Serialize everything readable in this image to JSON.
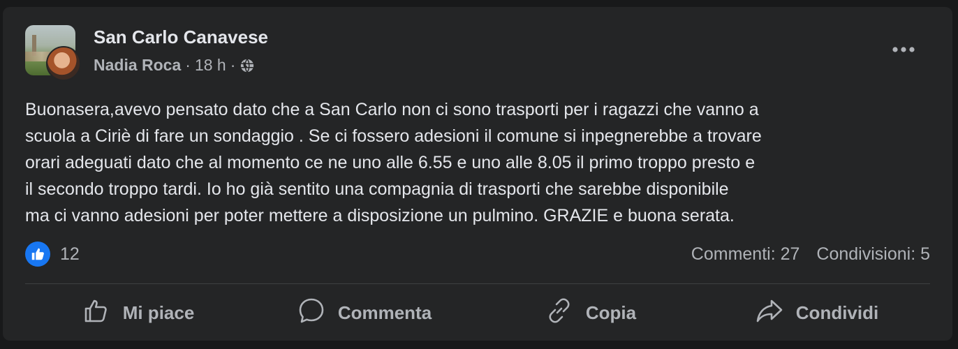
{
  "post": {
    "group_name": "San Carlo Canavese",
    "author": "Nadia Roca",
    "separator": "·",
    "time": "18 h",
    "more_label": "•••",
    "text": "Buonasera,avevo pensato dato che a San Carlo non ci sono trasporti per i ragazzi che vanno a\nscuola a Ciriè di fare un sondaggio . Se ci fossero adesioni il comune si inpegnerebbe a trovare\norari adeguati dato che al momento ce ne uno alle 6.55 e uno alle 8.05 il primo troppo presto e\nil secondo troppo tardi. Io ho già sentito una compagnia di trasporti che sarebbe disponibile\nma ci vanno adesioni per poter mettere a disposizione un pulmino. GRAZIE e buona serata.",
    "icons": {
      "privacy": "globe-icon",
      "reaction": "thumbs-up-icon",
      "more": "more-horizontal-icon"
    }
  },
  "engagement": {
    "reaction_count": "12",
    "comments": "Commenti: 27",
    "shares": "Condivisioni: 5"
  },
  "actions": [
    {
      "label": "Mi piace",
      "icon": "thumbs-up-outline-icon"
    },
    {
      "label": "Commenta",
      "icon": "comment-bubble-icon"
    },
    {
      "label": "Copia",
      "icon": "link-icon"
    },
    {
      "label": "Condividi",
      "icon": "share-arrow-icon"
    }
  ],
  "colors": {
    "background": "#18191a",
    "card": "#242526",
    "text_primary": "#e4e6eb",
    "text_secondary": "#b0b3b8",
    "accent": "#1877f2",
    "divider": "#3e4042"
  }
}
